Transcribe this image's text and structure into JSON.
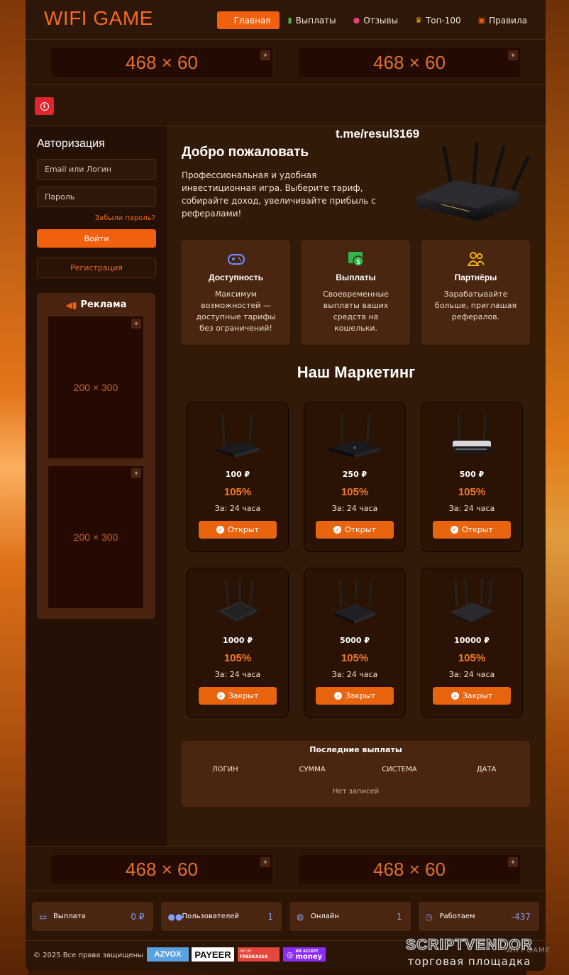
{
  "header": {
    "logo": "WIFI GAME",
    "nav": [
      {
        "label": "Главная",
        "icon": "home-icon",
        "active": true
      },
      {
        "label": "Выплаты",
        "icon": "bars-icon"
      },
      {
        "label": "Отзывы",
        "icon": "chat-icon"
      },
      {
        "label": "Топ-100",
        "icon": "trophy-icon"
      },
      {
        "label": "Правила",
        "icon": "clipboard-icon"
      }
    ]
  },
  "banners": {
    "top_left": "468 × 60",
    "top_right": "468 × 60",
    "bottom_left": "468 × 60",
    "bottom_right": "468 × 60",
    "plus": "+"
  },
  "alert": {
    "icon": "i"
  },
  "auth": {
    "title": "Авторизация",
    "login_placeholder": "Email или Логин",
    "password_placeholder": "Пароль",
    "forgot": "Забыли пароль?",
    "login_btn": "Войти",
    "register_btn": "Регистрация"
  },
  "ads": {
    "title": "Реклама",
    "slot1": "200 × 300",
    "slot2": "200 × 300"
  },
  "tme": "t.me/resul3169",
  "welcome": {
    "title": "Добро пожаловать",
    "text": "Профессиональная и удобная инвестиционная игра. Выберите тариф, собирайте доход, увеличивайте прибыль с рефералами!"
  },
  "features": [
    {
      "title": "Доступность",
      "desc": "Максимум возможностей — доступные тарифы без ограничений!",
      "icon": "gamepad-icon"
    },
    {
      "title": "Выплаты",
      "desc": "Своевременные выплаты ваших средств на кошельки.",
      "icon": "money-icon"
    },
    {
      "title": "Партнёры",
      "desc": "Зарабатывайте больше, приглашая рефералов.",
      "icon": "users-icon"
    }
  ],
  "marketing_title": "Наш Маркетинг",
  "plans": [
    {
      "price": "100 ₽",
      "pct": "105%",
      "term": "За: 24 часа",
      "btn": "Открыт"
    },
    {
      "price": "250 ₽",
      "pct": "105%",
      "term": "За: 24 часа",
      "btn": "Открыт"
    },
    {
      "price": "500 ₽",
      "pct": "105%",
      "term": "За: 24 часа",
      "btn": "Открыт"
    },
    {
      "price": "1000 ₽",
      "pct": "105%",
      "term": "За: 24 часа",
      "btn": "Закрыт"
    },
    {
      "price": "5000 ₽",
      "pct": "105%",
      "term": "За: 24 часа",
      "btn": "Закрыт"
    },
    {
      "price": "10000 ₽",
      "pct": "105%",
      "term": "За: 24 часа",
      "btn": "Закрыт"
    }
  ],
  "payouts": {
    "title": "Последние выплаты",
    "columns": [
      "ЛОГИН",
      "СУММА",
      "СИСТЕМА",
      "ДАТА"
    ],
    "empty": "Нет записей"
  },
  "stats": [
    {
      "label": "Выплата",
      "value": "0 ₽",
      "icon": "wallet-icon"
    },
    {
      "label": "Пользователей",
      "value": "1",
      "icon": "users-icon"
    },
    {
      "label": "Онлайн",
      "value": "1",
      "icon": "globe-icon"
    },
    {
      "label": "Работаем",
      "value": "-437",
      "icon": "clock-icon"
    }
  ],
  "footer": {
    "copy": "© 2025 Все права защищены",
    "payments": [
      "AZVOX",
      "PAYEER",
      "FREEKASSA",
      "money"
    ],
    "freekassa_top": "PAY BY",
    "yoomoney_top": "WE ACCEPT"
  },
  "watermark": {
    "line1": "SCRIPTVENDOR",
    "line2": "торговая площадка",
    "behind": "WIFI GAME"
  },
  "colors": {
    "accent": "#f0600f",
    "bg": "#2b1506",
    "panel": "#4a2510",
    "stat_value": "#7fa0ff"
  }
}
